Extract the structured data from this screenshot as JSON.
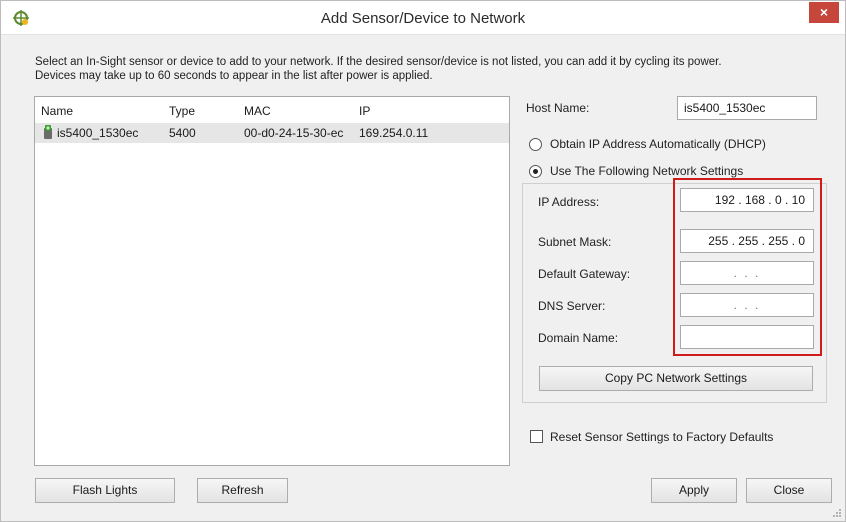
{
  "window": {
    "title": "Add Sensor/Device to Network",
    "close_glyph": "×"
  },
  "instructions": {
    "line1": "Select an In-Sight sensor or device to add to your network.  If the desired sensor/device is not listed, you can add it by cycling its power.",
    "line2": "Devices may take up to 60 seconds to appear in the list after power is applied."
  },
  "device_list": {
    "columns": [
      "Name",
      "Type",
      "MAC",
      "IP"
    ],
    "rows": [
      {
        "name": "is5400_1530ec",
        "type": "5400",
        "mac": "00-d0-24-15-30-ec",
        "ip": "169.254.0.11"
      }
    ]
  },
  "host_name": {
    "label": "Host Name:",
    "value": "is5400_1530ec"
  },
  "network_mode": {
    "dhcp_label": "Obtain IP Address Automatically (DHCP)",
    "static_label": "Use The Following Network Settings",
    "selected": "static"
  },
  "settings": {
    "ip_address": {
      "label": "IP Address:",
      "value": "192 . 168 .  0  .  10"
    },
    "subnet_mask": {
      "label": "Subnet Mask:",
      "value": "255 . 255 . 255 .  0"
    },
    "default_gateway": {
      "label": "Default Gateway:",
      "value": ".     .     ."
    },
    "dns_server": {
      "label": "DNS Server:",
      "value": ".     .     ."
    },
    "domain_name": {
      "label": "Domain Name:",
      "value": ""
    }
  },
  "copy_button": "Copy PC Network Settings",
  "reset_checkbox": {
    "label": "Reset Sensor Settings to Factory Defaults",
    "checked": false
  },
  "buttons": {
    "flash_lights": "Flash Lights",
    "refresh": "Refresh",
    "apply": "Apply",
    "close": "Close"
  },
  "colors": {
    "highlight": "#d11a1a",
    "close_button": "#c7463c",
    "sensor_icon": "#3a9a3a"
  },
  "icons": [
    "app-icon",
    "sensor-icon",
    "close-icon",
    "resize-grip-icon"
  ]
}
